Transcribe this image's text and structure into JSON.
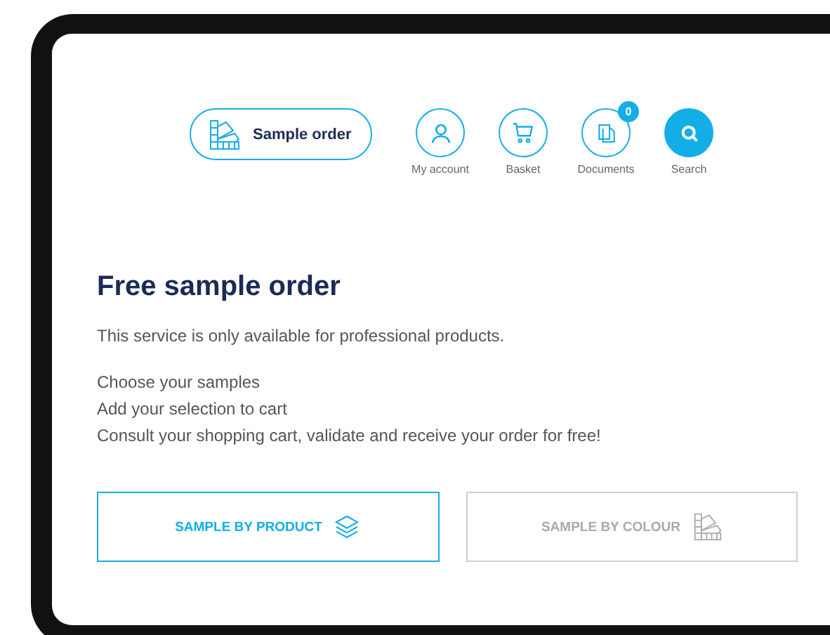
{
  "header": {
    "sample_order": {
      "label": "Sample order"
    },
    "nav": [
      {
        "kind": "account",
        "label": "My account",
        "selected": false
      },
      {
        "kind": "basket",
        "label": "Basket",
        "selected": false
      },
      {
        "kind": "documents",
        "label": "Documents",
        "badge": "0",
        "selected": false
      },
      {
        "kind": "search",
        "label": "Search",
        "selected": true
      }
    ]
  },
  "title": "Free sample order",
  "intro": "This service is only available for professional products.",
  "steps": [
    "Choose your samples",
    "Add your selection to cart",
    "Consult your shopping cart, validate and receive your order for free!"
  ],
  "tabs": [
    {
      "kind": "product",
      "label": "SAMPLE BY PRODUCT",
      "selected": true
    },
    {
      "kind": "colour",
      "label": "SAMPLE BY COLOUR",
      "selected": false
    }
  ]
}
